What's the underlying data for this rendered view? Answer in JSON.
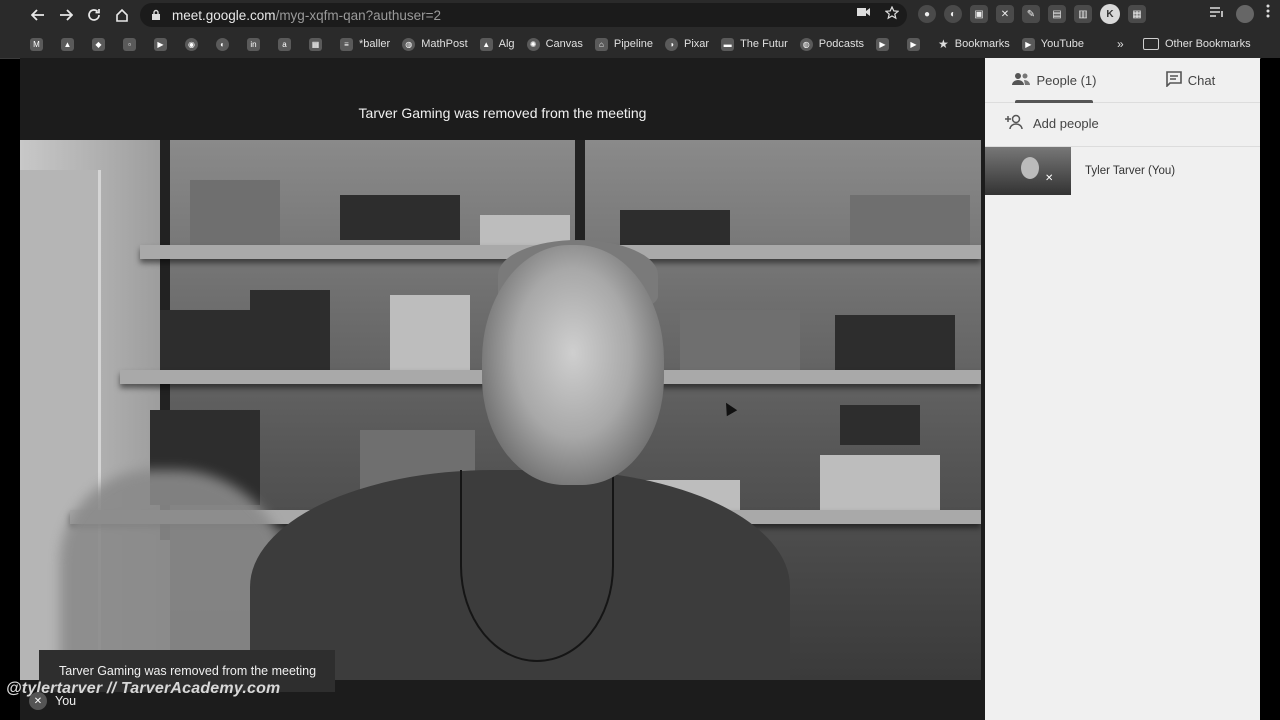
{
  "browser": {
    "url_host": "meet.google.com",
    "url_path": "/myg-xqfm-qan?authuser=2",
    "profile_initial": "K"
  },
  "bookmarks": {
    "items": [
      {
        "label": "",
        "icon": "gmail-icon"
      },
      {
        "label": "",
        "icon": "drive-icon"
      },
      {
        "label": "",
        "icon": "maps-icon"
      },
      {
        "label": "",
        "icon": "app-icon"
      },
      {
        "label": "",
        "icon": "youtube-icon"
      },
      {
        "label": "",
        "icon": "app-icon"
      },
      {
        "label": "",
        "icon": "app-icon"
      },
      {
        "label": "",
        "icon": "linkedin-icon"
      },
      {
        "label": "",
        "icon": "amazon-icon"
      },
      {
        "label": "",
        "icon": "app-icon"
      },
      {
        "label": "*baller",
        "icon": "page-icon"
      },
      {
        "label": "MathPost",
        "icon": "globe-icon"
      },
      {
        "label": "Alg",
        "icon": "app-icon"
      },
      {
        "label": "Canvas",
        "icon": "canvas-icon"
      },
      {
        "label": "Pipeline",
        "icon": "app-icon"
      },
      {
        "label": "Pixar",
        "icon": "app-icon"
      },
      {
        "label": "The Futur",
        "icon": "app-icon"
      },
      {
        "label": "Podcasts",
        "icon": "globe-icon"
      },
      {
        "label": "",
        "icon": "youtube-icon"
      },
      {
        "label": "",
        "icon": "youtube-icon"
      },
      {
        "label": "Bookmarks",
        "icon": "star-icon"
      },
      {
        "label": "YouTube",
        "icon": "youtube-icon"
      }
    ],
    "more": "»",
    "other": "Other Bookmarks"
  },
  "meet": {
    "stage_message": "Tarver Gaming was removed from the meeting",
    "toast_message": "Tarver Gaming was removed from the meeting",
    "watermark": "@tylertarver // TarverAcademy.com",
    "self_label": "You"
  },
  "panel": {
    "tab_people": "People (1)",
    "tab_chat": "Chat",
    "add_people": "Add people",
    "participants": [
      {
        "name": "Tyler Tarver (You)"
      }
    ]
  }
}
